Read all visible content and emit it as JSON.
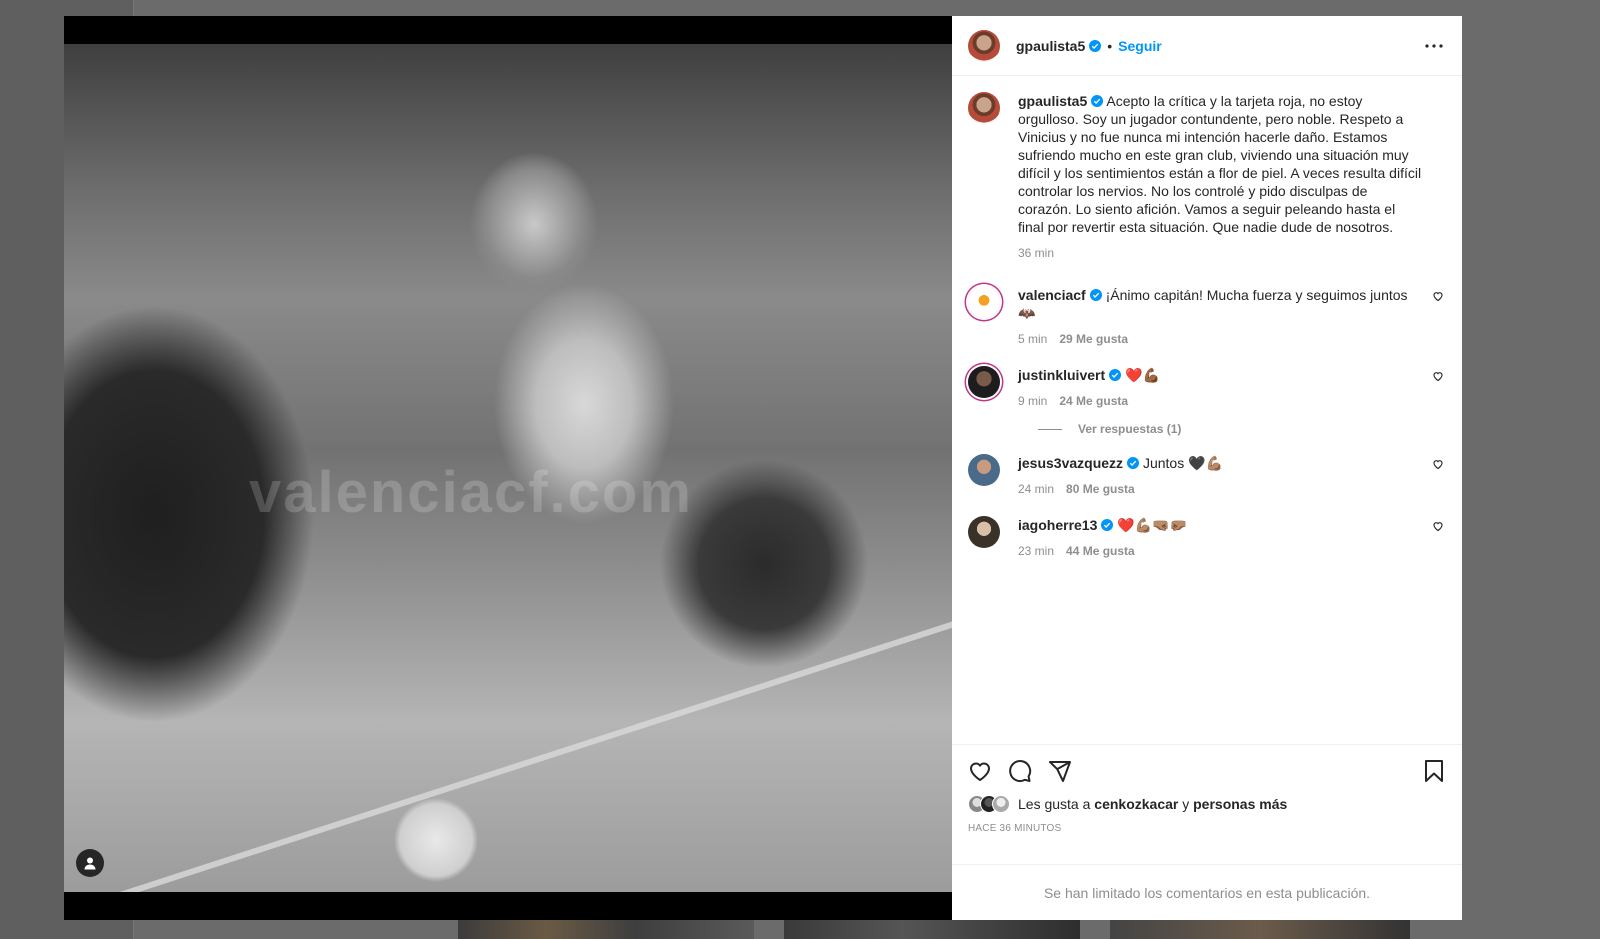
{
  "post": {
    "author": "gpaulista5",
    "follow_label": "Seguir",
    "separator": "•",
    "image_watermark": "valenciacf.com"
  },
  "caption": {
    "username": "gpaulista5",
    "text": "Acepto la crítica y la tarjeta roja, no estoy orgulloso. Soy un jugador contundente, pero noble. Respeto a Vinicius y no fue nunca mi intención hacerle daño. Estamos sufriendo mucho en este gran club, viviendo una situación muy difícil y los sentimientos están a flor de piel. A veces resulta difícil controlar los nervios. No los controlé y pido disculpas de corazón. Lo siento afición. Vamos a seguir peleando hasta el final por revertir esta situación. Que nadie dude de nosotros.",
    "time": "36 min"
  },
  "comments": [
    {
      "username": "valenciacf",
      "text": "¡Ánimo capitán! Mucha fuerza y seguimos juntos 🦇",
      "time": "5 min",
      "likes": "29 Me gusta"
    },
    {
      "username": "justinkluivert",
      "text": "❤️💪🏾",
      "time": "9 min",
      "likes": "24 Me gusta",
      "replies": "Ver respuestas (1)"
    },
    {
      "username": "jesus3vazquezz",
      "text": "Juntos 🖤💪🏽",
      "time": "24 min",
      "likes": "80 Me gusta"
    },
    {
      "username": "iagoherre13",
      "text": "❤️💪🏽🤜🏽🤛🏽",
      "time": "23 min",
      "likes": "44 Me gusta"
    }
  ],
  "likes": {
    "prefix": "Les gusta a",
    "user": "cenkozkacar",
    "joiner": "y",
    "others": "personas más"
  },
  "timestamp": "Hace 36 minutos",
  "comments_limited": "Se han limitado los comentarios en esta publicación.",
  "colors": {
    "follow": "#0095f6",
    "secondary_text": "#8e8e8e",
    "verified": "#0095f6"
  }
}
